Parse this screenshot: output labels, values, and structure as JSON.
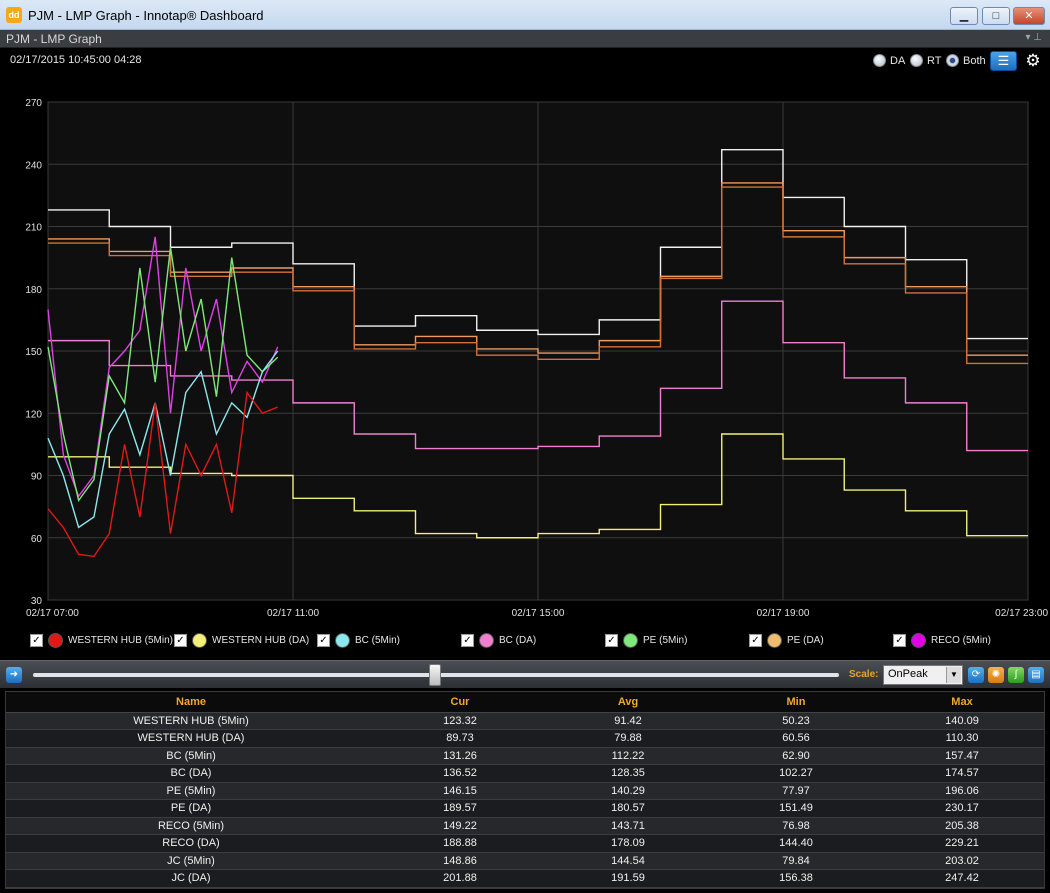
{
  "window": {
    "title": "PJM - LMP Graph - Innotap® Dashboard",
    "icon": "dd"
  },
  "panel": {
    "title": "PJM - LMP Graph"
  },
  "header": {
    "datetime": "02/17/2015 10:45:00  04:28",
    "radios": [
      {
        "label": "DA",
        "selected": false
      },
      {
        "label": "RT",
        "selected": false
      },
      {
        "label": "Both",
        "selected": true
      }
    ]
  },
  "chart_data": {
    "type": "line",
    "xlim": [
      0,
      16
    ],
    "ylim": [
      30,
      270
    ],
    "yticks": [
      30,
      60,
      90,
      120,
      150,
      180,
      210,
      240,
      270
    ],
    "xtick_positions": [
      0,
      4,
      8,
      12,
      16
    ],
    "xtick_labels": [
      "02/17 07:00",
      "02/17 11:00",
      "02/17 15:00",
      "02/17 19:00",
      "02/17 23:00"
    ],
    "grid": true,
    "series": [
      {
        "name": "JC (DA)",
        "color": "#f2f2f2",
        "kind": "step",
        "x": [
          0,
          1,
          2,
          3,
          4,
          5,
          6,
          7,
          8,
          9,
          10,
          11,
          12,
          13,
          14,
          15,
          16
        ],
        "y": [
          218,
          210,
          200,
          202,
          192,
          162,
          167,
          160,
          158,
          165,
          200,
          247,
          224,
          210,
          194,
          156,
          156
        ]
      },
      {
        "name": "RECO (DA)",
        "color": "#ee9b62",
        "kind": "step",
        "x": [
          0,
          1,
          2,
          3,
          4,
          5,
          6,
          7,
          8,
          9,
          10,
          11,
          12,
          13,
          14,
          15,
          16
        ],
        "y": [
          204,
          198,
          188,
          190,
          181,
          153,
          157,
          151,
          149,
          155,
          186,
          231,
          208,
          195,
          181,
          148,
          148
        ]
      },
      {
        "name": "PE (DA)",
        "color": "#d4703a",
        "kind": "step",
        "x": [
          0,
          1,
          2,
          3,
          4,
          5,
          6,
          7,
          8,
          9,
          10,
          11,
          12,
          13,
          14,
          15,
          16
        ],
        "y": [
          202,
          196,
          186,
          188,
          179,
          151,
          154,
          148,
          146,
          152,
          185,
          229,
          205,
          192,
          178,
          144,
          144
        ]
      },
      {
        "name": "BC (DA)",
        "color": "#f07fd0",
        "kind": "step",
        "x": [
          0,
          1,
          2,
          3,
          4,
          5,
          6,
          7,
          8,
          9,
          10,
          11,
          12,
          13,
          14,
          15,
          16
        ],
        "y": [
          155,
          143,
          138,
          136,
          125,
          110,
          103,
          103,
          104,
          109,
          132,
          174,
          154,
          137,
          125,
          102,
          102
        ]
      },
      {
        "name": "WESTERN HUB (DA)",
        "color": "#f3ef79",
        "kind": "step",
        "x": [
          0,
          1,
          2,
          3,
          4,
          5,
          6,
          7,
          8,
          9,
          10,
          11,
          12,
          13,
          14,
          15,
          16
        ],
        "y": [
          99,
          94,
          91,
          90,
          79,
          73,
          62,
          60,
          62,
          64,
          76,
          110,
          98,
          83,
          73,
          61,
          61
        ]
      },
      {
        "name": "RECO (5Min)",
        "color": "#e040e6",
        "kind": "line",
        "x": [
          0,
          0.25,
          0.5,
          0.75,
          1,
          1.25,
          1.5,
          1.75,
          2,
          2.25,
          2.5,
          2.75,
          3,
          3.25,
          3.5,
          3.75
        ],
        "y": [
          170,
          100,
          80,
          90,
          142,
          150,
          160,
          205,
          120,
          190,
          150,
          175,
          130,
          145,
          135,
          152
        ]
      },
      {
        "name": "PE (5Min)",
        "color": "#7fe87a",
        "kind": "line",
        "x": [
          0,
          0.25,
          0.5,
          0.75,
          1,
          1.25,
          1.5,
          1.75,
          2,
          2.25,
          2.5,
          2.75,
          3,
          3.25,
          3.5,
          3.75
        ],
        "y": [
          152,
          110,
          78,
          88,
          138,
          125,
          190,
          135,
          200,
          150,
          175,
          128,
          195,
          148,
          140,
          147
        ]
      },
      {
        "name": "BC (5Min)",
        "color": "#8de8ee",
        "kind": "line",
        "x": [
          0,
          0.25,
          0.5,
          0.75,
          1,
          1.25,
          1.5,
          1.75,
          2,
          2.25,
          2.5,
          2.75,
          3,
          3.25,
          3.5,
          3.75
        ],
        "y": [
          108,
          90,
          65,
          70,
          110,
          122,
          100,
          125,
          90,
          130,
          140,
          110,
          125,
          118,
          140,
          150
        ]
      },
      {
        "name": "WESTERN HUB (5Min)",
        "color": "#e01818",
        "kind": "line",
        "x": [
          0,
          0.25,
          0.5,
          0.75,
          1,
          1.25,
          1.5,
          1.75,
          2,
          2.25,
          2.5,
          2.75,
          3,
          3.25,
          3.5,
          3.75
        ],
        "y": [
          74,
          65,
          52,
          51,
          62,
          105,
          70,
          125,
          62,
          105,
          90,
          105,
          72,
          130,
          120,
          123
        ]
      }
    ]
  },
  "legend": [
    {
      "label": "WESTERN HUB (5Min)",
      "color": "#e01818",
      "checked": true
    },
    {
      "label": "WESTERN HUB (DA)",
      "color": "#f3ef79",
      "checked": true
    },
    {
      "label": "BC (5Min)",
      "color": "#8de8ee",
      "checked": true
    },
    {
      "label": "BC (DA)",
      "color": "#f07fd0",
      "checked": true
    },
    {
      "label": "PE (5Min)",
      "color": "#7fe87a",
      "checked": true
    },
    {
      "label": "PE (DA)",
      "color": "#f0bd6e",
      "checked": true
    },
    {
      "label": "RECO (5Min)",
      "color": "#e000e8",
      "checked": true
    }
  ],
  "slider": {
    "scale_label": "Scale:",
    "scale_value": "OnPeak",
    "position": 0.5
  },
  "table": {
    "headers": [
      "Name",
      "Cur",
      "Avg",
      "Min",
      "Max"
    ],
    "rows": [
      [
        "WESTERN HUB (5Min)",
        "123.32",
        "91.42",
        "50.23",
        "140.09"
      ],
      [
        "WESTERN HUB (DA)",
        "89.73",
        "79.88",
        "60.56",
        "110.30"
      ],
      [
        "BC (5Min)",
        "131.26",
        "112.22",
        "62.90",
        "157.47"
      ],
      [
        "BC (DA)",
        "136.52",
        "128.35",
        "102.27",
        "174.57"
      ],
      [
        "PE (5Min)",
        "146.15",
        "140.29",
        "77.97",
        "196.06"
      ],
      [
        "PE (DA)",
        "189.57",
        "180.57",
        "151.49",
        "230.17"
      ],
      [
        "RECO (5Min)",
        "149.22",
        "143.71",
        "76.98",
        "205.38"
      ],
      [
        "RECO (DA)",
        "188.88",
        "178.09",
        "144.40",
        "229.21"
      ],
      [
        "JC (5Min)",
        "148.86",
        "144.54",
        "79.84",
        "203.02"
      ],
      [
        "JC (DA)",
        "201.88",
        "191.59",
        "156.38",
        "247.42"
      ]
    ]
  }
}
